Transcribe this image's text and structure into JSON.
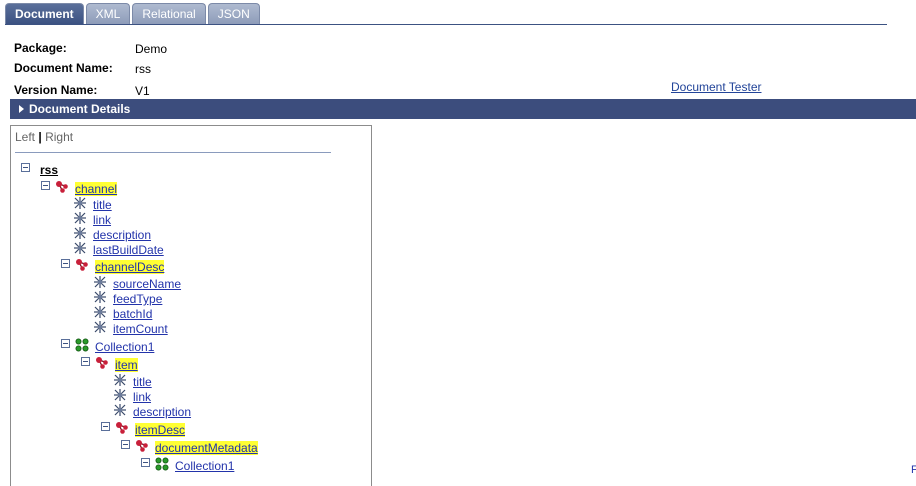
{
  "tabs": [
    "Document",
    "XML",
    "Relational",
    "JSON"
  ],
  "header": {
    "package_label": "Package:",
    "package_value": "Demo",
    "docname_label": "Document Name:",
    "docname_value": "rss",
    "version_label": "Version Name:",
    "version_value": "V1",
    "tester_link": "Document Tester"
  },
  "section": {
    "title": "Document Details"
  },
  "panel": {
    "left": "Left",
    "sep": "|",
    "right": "Right"
  },
  "tree": [
    {
      "label": "rss",
      "type": "root",
      "depth": 0,
      "box": true
    },
    {
      "label": "channel",
      "type": "compound",
      "depth": 1,
      "box": true,
      "highlight": true
    },
    {
      "label": "title",
      "type": "primitive",
      "depth": 2
    },
    {
      "label": "link",
      "type": "primitive",
      "depth": 2
    },
    {
      "label": "description",
      "type": "primitive",
      "depth": 2
    },
    {
      "label": "lastBuildDate",
      "type": "primitive",
      "depth": 2
    },
    {
      "label": "channelDesc",
      "type": "compound",
      "depth": 2,
      "box": true,
      "highlight": true
    },
    {
      "label": "sourceName",
      "type": "primitive",
      "depth": 3
    },
    {
      "label": "feedType",
      "type": "primitive",
      "depth": 3
    },
    {
      "label": "batchId",
      "type": "primitive",
      "depth": 3
    },
    {
      "label": "itemCount",
      "type": "primitive",
      "depth": 3
    },
    {
      "label": "Collection1",
      "type": "collection",
      "depth": 2,
      "box": true
    },
    {
      "label": "item",
      "type": "compound",
      "depth": 3,
      "box": true,
      "highlight": true
    },
    {
      "label": "title",
      "type": "primitive",
      "depth": 4
    },
    {
      "label": "link",
      "type": "primitive",
      "depth": 4
    },
    {
      "label": "description",
      "type": "primitive",
      "depth": 4
    },
    {
      "label": "itemDesc",
      "type": "compound",
      "depth": 4,
      "box": true,
      "highlight": true
    },
    {
      "label": "documentMetadata",
      "type": "compound",
      "depth": 5,
      "box": true,
      "highlight": true
    },
    {
      "label": "Collection1",
      "type": "collection",
      "depth": 6,
      "box": true
    }
  ],
  "edge_text": "F"
}
